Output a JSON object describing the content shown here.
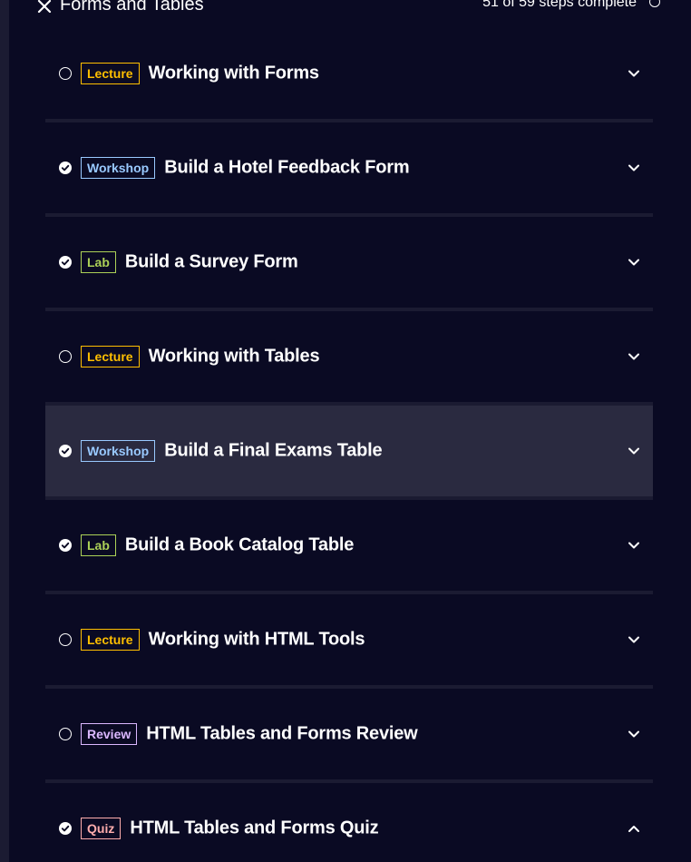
{
  "header": {
    "title": "Forms and Tables",
    "progress": "51 of 59 steps complete"
  },
  "colors": {
    "background": "#1b1b32",
    "panel": "#0a0a23",
    "highlight_row": "#2a2a40",
    "lecture": "#ffbf00",
    "workshop": "#99c9ff",
    "lab": "#acd157",
    "review": "#dbb8ff",
    "quiz": "#ffadad"
  },
  "steps": [
    {
      "type": "lecture",
      "badge": "Lecture",
      "title": "Working with Forms",
      "completed": false,
      "expanded": false,
      "status_icon": "empty-circle-icon"
    },
    {
      "type": "workshop",
      "badge": "Workshop",
      "title": "Build a Hotel Feedback Form",
      "completed": true,
      "expanded": false,
      "status_icon": "check-circle-icon"
    },
    {
      "type": "lab",
      "badge": "Lab",
      "title": "Build a Survey Form",
      "completed": true,
      "expanded": false,
      "status_icon": "check-circle-icon"
    },
    {
      "type": "lecture",
      "badge": "Lecture",
      "title": "Working with Tables",
      "completed": false,
      "expanded": false,
      "status_icon": "empty-circle-icon"
    },
    {
      "type": "workshop",
      "badge": "Workshop",
      "title": "Build a Final Exams Table",
      "completed": true,
      "expanded": false,
      "status_icon": "check-circle-icon"
    },
    {
      "type": "lab",
      "badge": "Lab",
      "title": "Build a Book Catalog Table",
      "completed": true,
      "expanded": false,
      "status_icon": "check-circle-icon"
    },
    {
      "type": "lecture",
      "badge": "Lecture",
      "title": "Working with HTML Tools",
      "completed": false,
      "expanded": false,
      "status_icon": "empty-circle-icon"
    },
    {
      "type": "review",
      "badge": "Review",
      "title": "HTML Tables and Forms Review",
      "completed": false,
      "expanded": false,
      "status_icon": "empty-circle-icon"
    },
    {
      "type": "quiz",
      "badge": "Quiz",
      "title": "HTML Tables and Forms Quiz",
      "completed": true,
      "expanded": true,
      "status_icon": "check-circle-icon"
    }
  ]
}
